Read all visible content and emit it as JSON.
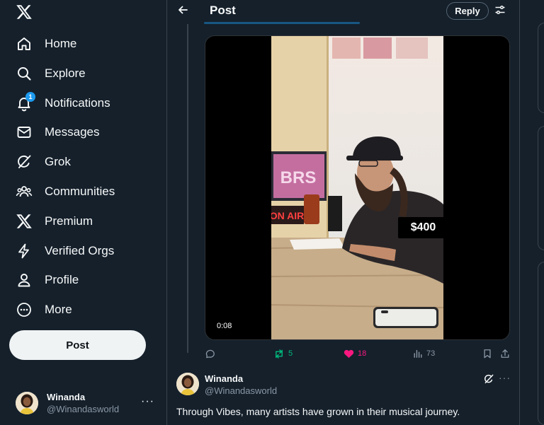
{
  "sidebar": {
    "logo_icon": "x-logo",
    "nav": [
      {
        "label": "Home",
        "icon": "home-icon"
      },
      {
        "label": "Explore",
        "icon": "search-icon"
      },
      {
        "label": "Notifications",
        "icon": "bell-icon",
        "badge": "1"
      },
      {
        "label": "Messages",
        "icon": "envelope-icon"
      },
      {
        "label": "Grok",
        "icon": "grok-icon"
      },
      {
        "label": "Communities",
        "icon": "people-icon"
      },
      {
        "label": "Premium",
        "icon": "x-logo"
      },
      {
        "label": "Verified Orgs",
        "icon": "lightning-icon"
      },
      {
        "label": "Profile",
        "icon": "person-icon"
      },
      {
        "label": "More",
        "icon": "more-circle-icon"
      }
    ],
    "post_label": "Post",
    "account": {
      "name": "Winanda",
      "handle": "@Winandasworld",
      "more": "···"
    }
  },
  "header": {
    "title": "Post",
    "reply_label": "Reply"
  },
  "media": {
    "timestamp": "0:08",
    "price_tag": "$400",
    "sign_text": "ON AIR",
    "screen_text": "BRS"
  },
  "actions": {
    "replies": "",
    "reposts": "5",
    "likes": "18",
    "views": "73"
  },
  "reply_tweet": {
    "name": "Winanda",
    "handle": "@Winandasworld",
    "more": "···",
    "text": "Through Vibes, many artists have grown in their musical journey."
  },
  "colors": {
    "background": "#15202b",
    "text": "#f7f9f9",
    "muted": "#8b98a5",
    "accent": "#1d9bf0",
    "repost": "#00ba7c",
    "like": "#f91880",
    "border": "#38444d"
  }
}
